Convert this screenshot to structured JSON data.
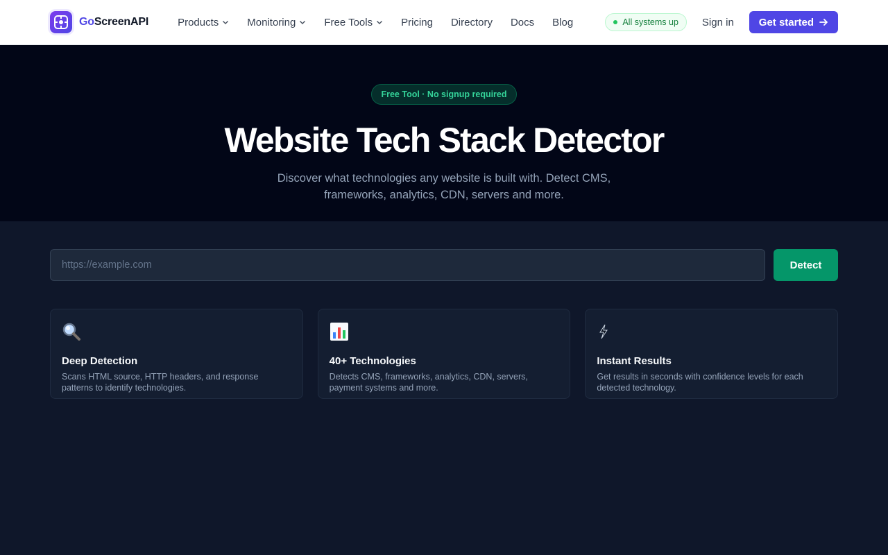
{
  "nav": {
    "brand_prefix": "Go",
    "brand_suffix": "ScreenAPI",
    "links": [
      {
        "label": "Products",
        "dropdown": true
      },
      {
        "label": "Monitoring",
        "dropdown": true
      },
      {
        "label": "Free Tools",
        "dropdown": true
      },
      {
        "label": "Pricing",
        "dropdown": false
      },
      {
        "label": "Directory",
        "dropdown": false
      },
      {
        "label": "Docs",
        "dropdown": false
      },
      {
        "label": "Blog",
        "dropdown": false
      }
    ],
    "status": "All systems up",
    "signin": "Sign in",
    "cta": "Get started"
  },
  "hero": {
    "badge": "Free Tool · No signup required",
    "title": "Website Tech Stack Detector",
    "subtitle": "Discover what technologies any website is built with. Detect CMS, frameworks, analytics, CDN, servers and more."
  },
  "search": {
    "placeholder": "https://example.com",
    "value": "",
    "button": "Detect"
  },
  "features": [
    {
      "icon": "magnifier-icon",
      "title": "Deep Detection",
      "desc": "Scans HTML source, HTTP headers, and response patterns to identify technologies."
    },
    {
      "icon": "bar-chart-icon",
      "title": "40+ Technologies",
      "desc": "Detects CMS, frameworks, analytics, CDN, servers, payment systems and more."
    },
    {
      "icon": "lightning-icon",
      "title": "Instant Results",
      "desc": "Get results in seconds with confidence levels for each detected technology."
    }
  ],
  "colors": {
    "accent": "#4f46e5",
    "success": "#059669",
    "hero_bg": "#020617",
    "page_bg": "#0f172a"
  }
}
